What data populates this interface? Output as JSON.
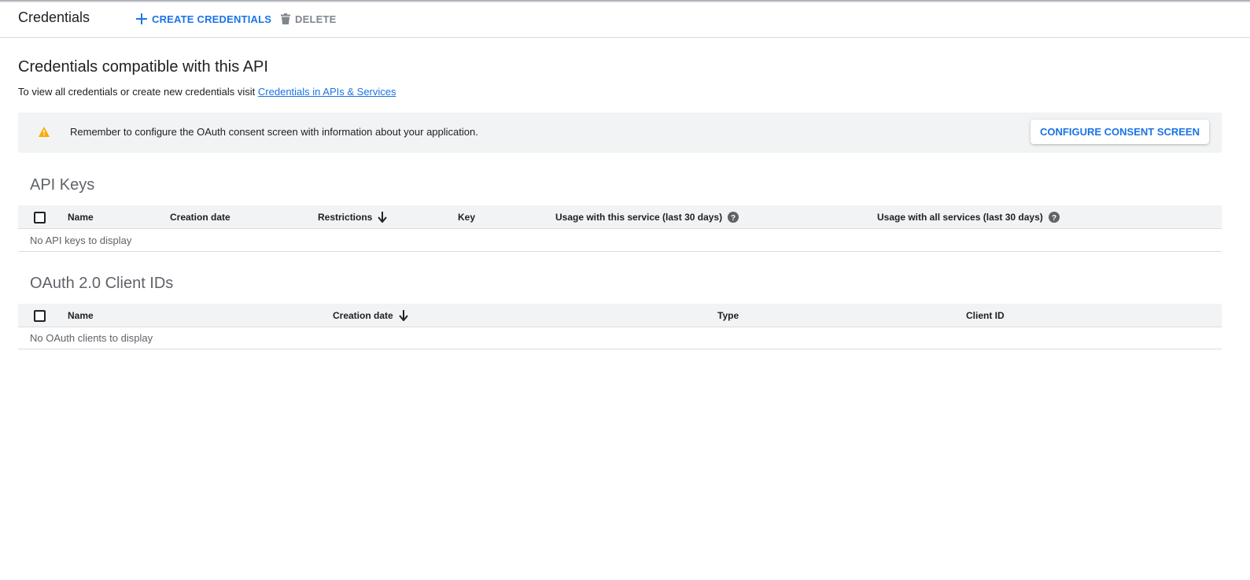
{
  "header": {
    "title": "Credentials",
    "create_label": "CREATE CREDENTIALS",
    "delete_label": "DELETE"
  },
  "main": {
    "heading": "Credentials compatible with this API",
    "intro_text": "To view all credentials or create new credentials visit ",
    "intro_link": "Credentials in APIs & Services"
  },
  "banner": {
    "icon": "warning-icon",
    "message": "Remember to configure the OAuth consent screen with information about your application.",
    "button_label": "CONFIGURE CONSENT SCREEN"
  },
  "api_keys": {
    "title": "API Keys",
    "columns": [
      "Name",
      "Creation date",
      "Restrictions",
      "Key",
      "Usage with this service (last 30 days)",
      "Usage with all services (last 30 days)"
    ],
    "empty_text": "No API keys to display"
  },
  "oauth": {
    "title": "OAuth 2.0 Client IDs",
    "columns": [
      "Name",
      "Creation date",
      "Type",
      "Client ID"
    ],
    "empty_text": "No OAuth clients to display"
  },
  "colors": {
    "accent": "#1a73e8",
    "warning": "#f9ab00",
    "muted": "#5f6368"
  }
}
